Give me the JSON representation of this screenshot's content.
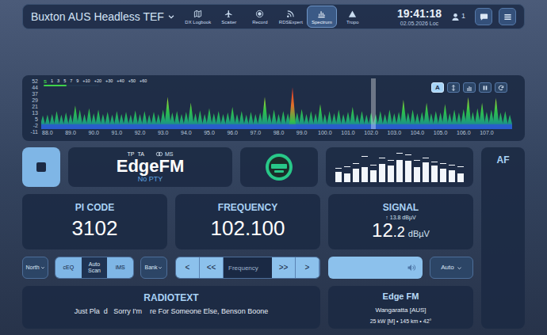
{
  "header": {
    "title": "Buxton AUS Headless TEF",
    "nav": [
      {
        "label": "DX Logbook",
        "kind": "map",
        "selected": false
      },
      {
        "label": "Scatter",
        "kind": "plane",
        "selected": false
      },
      {
        "label": "Record",
        "kind": "record",
        "selected": false
      },
      {
        "label": "RDSExpert",
        "kind": "rss",
        "selected": false
      },
      {
        "label": "Spectrum",
        "kind": "spectrum",
        "selected": true
      },
      {
        "label": "Tropo",
        "kind": "tropo",
        "selected": false
      }
    ],
    "time": "19:41:18",
    "date": "02.05.2026 Loc",
    "users": "1"
  },
  "spectrum": {
    "y_ticks": [
      "52",
      "44",
      "37",
      "29",
      "21",
      "13",
      "5",
      "-2",
      "-11"
    ],
    "x_ticks": [
      "88.0",
      "89.0",
      "90.0",
      "91.0",
      "92.0",
      "93.0",
      "94.0",
      "95.0",
      "96.0",
      "97.0",
      "98.0",
      "99.0",
      "100.0",
      "101.0",
      "102.0",
      "103.0",
      "104.0",
      "105.0",
      "106.0",
      "107.0"
    ],
    "scale": {
      "labels": [
        "S",
        "1",
        "3",
        "5",
        "7",
        "9",
        "+10",
        "+20",
        "+30",
        "+40",
        "+50",
        "+60"
      ],
      "level": 0.42
    },
    "buttons": [
      {
        "kind": "text",
        "label": "A",
        "selected": true
      },
      {
        "kind": "zoom",
        "selected": false
      },
      {
        "kind": "bars",
        "selected": false
      },
      {
        "kind": "pause",
        "selected": false
      },
      {
        "kind": "refresh",
        "selected": false
      }
    ],
    "start": 87.8,
    "step": 0.2,
    "values": [
      4,
      5,
      6,
      10,
      5,
      8,
      6,
      18,
      12,
      6,
      14,
      7,
      12,
      6,
      9,
      5,
      10,
      6,
      9,
      5,
      11,
      6,
      10,
      5,
      9,
      6,
      12,
      30,
      8,
      10,
      6,
      9,
      22,
      7,
      11,
      6,
      14,
      7,
      10,
      6,
      8,
      16,
      6,
      10,
      5,
      9,
      6,
      8,
      30,
      7,
      12,
      6,
      10,
      7,
      44,
      8,
      13,
      6,
      10,
      7,
      20,
      6,
      10,
      7,
      12,
      6,
      9,
      16,
      6,
      10,
      5,
      8,
      6,
      10,
      6,
      12,
      7,
      9,
      26,
      8,
      12,
      7,
      9,
      22,
      7,
      10,
      8,
      20,
      7,
      12,
      8,
      13,
      30,
      9,
      14,
      22,
      9,
      12,
      29,
      8,
      10,
      5
    ],
    "highlight_frequency": 98.6,
    "cursor_frequency": 102.1
  },
  "play": {
    "playing": true
  },
  "station": {
    "flags": [
      {
        "label": "TP",
        "on": true
      },
      {
        "label": "TA",
        "on": true
      }
    ],
    "stereo": "MS",
    "name": "EdgeFM",
    "pty": "No PTY"
  },
  "audio_bars": [
    {
      "level": 0.35,
      "peak": 0.45
    },
    {
      "level": 0.3,
      "peak": 0.5
    },
    {
      "level": 0.45,
      "peak": 0.6
    },
    {
      "level": 0.5,
      "peak": 0.85
    },
    {
      "level": 0.4,
      "peak": 0.55
    },
    {
      "level": 0.6,
      "peak": 0.8
    },
    {
      "level": 0.55,
      "peak": 0.7
    },
    {
      "level": 0.75,
      "peak": 0.95
    },
    {
      "level": 0.7,
      "peak": 0.9
    },
    {
      "level": 0.5,
      "peak": 0.7
    },
    {
      "level": 0.65,
      "peak": 0.8
    },
    {
      "level": 0.55,
      "peak": 0.65
    },
    {
      "level": 0.45,
      "peak": 0.6
    },
    {
      "level": 0.4,
      "peak": 0.55
    },
    {
      "level": 0.3,
      "peak": 0.5
    }
  ],
  "pi": {
    "label": "PI CODE",
    "value": "3102"
  },
  "frequency": {
    "label": "FREQUENCY",
    "value": "102.100"
  },
  "signal": {
    "label": "SIGNAL",
    "peak": "↑ 13.8 dBµV",
    "value_int": "12",
    "value_dec": ".2",
    "unit": "dBµV"
  },
  "controls": {
    "antenna": "North",
    "toggles": [
      {
        "label": "cEQ",
        "on": true
      },
      {
        "label": "Auto Scan",
        "on": false
      },
      {
        "label": "iMS",
        "on": true
      }
    ],
    "bank": "Bank",
    "step_buttons": [
      "<",
      "<<",
      ">>",
      ">"
    ],
    "frequency_input": {
      "placeholder": "Frequency"
    },
    "volume": {
      "level": 1.0
    },
    "mode": "Auto"
  },
  "radiotext": {
    "label": "RADIOTEXT",
    "text": "Just Pla  d   Sorry I'm    re For Someone Else, Benson Boone"
  },
  "transmitter": {
    "name": "Edge FM",
    "city": "Wangaratta [AUS]",
    "details": "25 kW [M] • 145 km • 42°"
  },
  "af": {
    "label": "AF"
  }
}
